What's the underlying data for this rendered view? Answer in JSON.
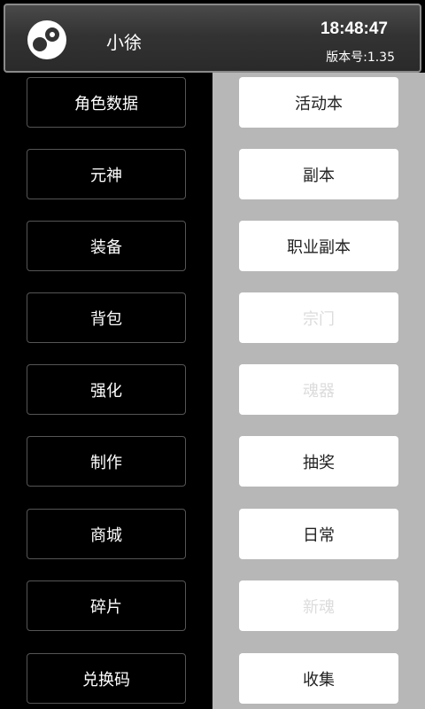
{
  "header": {
    "username": "小徐",
    "time": "18:48:47",
    "version": "版本号:1.35",
    "avatar_icon": "app-logo-icon"
  },
  "left_menu": [
    {
      "label": "角色数据"
    },
    {
      "label": "元神"
    },
    {
      "label": "装备"
    },
    {
      "label": "背包"
    },
    {
      "label": "强化"
    },
    {
      "label": "制作"
    },
    {
      "label": "商城"
    },
    {
      "label": "碎片"
    },
    {
      "label": "兑换码"
    }
  ],
  "right_menu": [
    {
      "label": "活动本",
      "enabled": true
    },
    {
      "label": "副本",
      "enabled": true
    },
    {
      "label": "职业副本",
      "enabled": true
    },
    {
      "label": "宗门",
      "enabled": false
    },
    {
      "label": "魂器",
      "enabled": false
    },
    {
      "label": "抽奖",
      "enabled": true
    },
    {
      "label": "日常",
      "enabled": true
    },
    {
      "label": "新魂",
      "enabled": false
    },
    {
      "label": "收集",
      "enabled": true
    }
  ],
  "colors": {
    "left_bg": "#000000",
    "right_bg": "#b7b7b7",
    "disabled_text": "#dcdcdc"
  }
}
